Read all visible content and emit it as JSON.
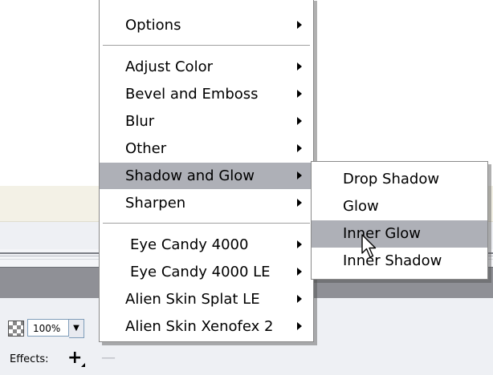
{
  "zoom": {
    "value": "100%"
  },
  "effects": {
    "label": "Effects:",
    "add_symbol": "+",
    "remove_symbol": "—"
  },
  "menu": {
    "items": [
      {
        "label": "Options",
        "has_submenu": true
      },
      {
        "label": "Adjust Color",
        "has_submenu": true
      },
      {
        "label": "Bevel and Emboss",
        "has_submenu": true
      },
      {
        "label": "Blur",
        "has_submenu": true
      },
      {
        "label": "Other",
        "has_submenu": true
      },
      {
        "label": "Shadow and Glow",
        "has_submenu": true,
        "highlighted": true
      },
      {
        "label": "Sharpen",
        "has_submenu": true
      },
      {
        "label": "Eye Candy 4000",
        "has_submenu": true
      },
      {
        "label": "Eye Candy 4000 LE",
        "has_submenu": true
      },
      {
        "label": "Alien Skin Splat LE",
        "has_submenu": true
      },
      {
        "label": "Alien Skin Xenofex 2",
        "has_submenu": true
      }
    ]
  },
  "submenu": {
    "items": [
      {
        "label": "Drop Shadow"
      },
      {
        "label": "Glow"
      },
      {
        "label": "Inner Glow",
        "highlighted": true
      },
      {
        "label": "Inner Shadow"
      }
    ]
  },
  "colors": {
    "highlight": "#aeb0b7",
    "toolbar_dark": "#8f9096",
    "panel": "#eef0f4",
    "beige": "#f3f1e6"
  },
  "icons": {
    "submenu_arrow": "triangle-right",
    "cursor": "arrow-pointer"
  }
}
